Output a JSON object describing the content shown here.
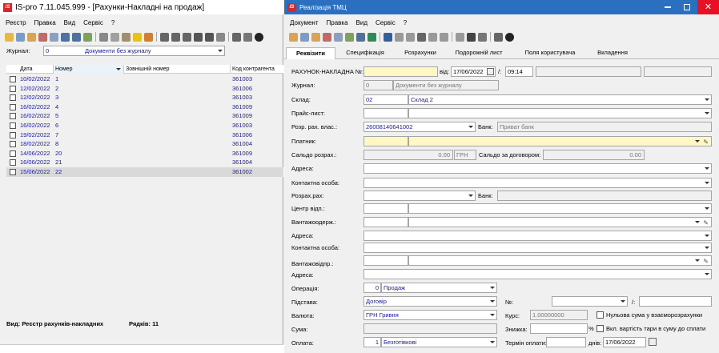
{
  "left_window": {
    "title": "IS-pro 7.11.045.999 - [Рахунки-Накладні на продаж]",
    "logo": "IS",
    "menu": [
      "Реєстр",
      "Правка",
      "Вид",
      "Сервіс",
      "?"
    ],
    "journal_label": "Журнал:",
    "journal_num": "0",
    "journal_value": "Документи без журналу",
    "columns": [
      "Дата",
      "Номер",
      "Зовнішній номер",
      "Код контрагента"
    ],
    "rows": [
      {
        "date": "10/02/2022",
        "num": "1",
        "ext": "",
        "code": "361003"
      },
      {
        "date": "12/02/2022",
        "num": "2",
        "ext": "",
        "code": "361006"
      },
      {
        "date": "12/02/2022",
        "num": "3",
        "ext": "",
        "code": "361003"
      },
      {
        "date": "16/02/2022",
        "num": "4",
        "ext": "",
        "code": "361009"
      },
      {
        "date": "16/02/2022",
        "num": "5",
        "ext": "",
        "code": "361009"
      },
      {
        "date": "16/02/2022",
        "num": "6",
        "ext": "",
        "code": "361003"
      },
      {
        "date": "19/02/2022",
        "num": "7",
        "ext": "",
        "code": "361006"
      },
      {
        "date": "18/02/2022",
        "num": "8",
        "ext": "",
        "code": "361004"
      },
      {
        "date": "14/06/2022",
        "num": "20",
        "ext": "",
        "code": "361009"
      },
      {
        "date": "16/06/2022",
        "num": "21",
        "ext": "",
        "code": "361004"
      },
      {
        "date": "15/06/2022",
        "num": "22",
        "ext": "",
        "code": "361002"
      }
    ],
    "status_view": "Вид: Реєстр рахунків-накладних",
    "status_rows": "Рядків: 11"
  },
  "dialog": {
    "title": "Реалізація ТМЦ",
    "menu": [
      "Документ",
      "Правка",
      "Вид",
      "Сервіс",
      "?"
    ],
    "tabs": [
      "Реквізити",
      "Специфікація",
      "Розрахунки",
      "Подорожній лист",
      "Поля користувача",
      "Вкладення"
    ],
    "invoice_label": "РАХУНОК-НАКЛАДНА №:",
    "invoice_num": "",
    "from_label": "від:",
    "date": "17/06/2022",
    "time": "09:14",
    "journal_label": "Журнал:",
    "journal_num": "0",
    "journal_value": "Документи без журналу",
    "warehouse_label": "Склад:",
    "warehouse_num": "02",
    "warehouse_value": "Склад 2",
    "pricelist_label": "Прайс-лист:",
    "own_account_label": "Розр. рах. влас.:",
    "own_account_value": "26008140641002",
    "bank_label": "Банк:",
    "bank_value": "Приват банк",
    "payer_label": "Платник:",
    "saldo_label": "Сальдо розрах.:",
    "saldo_value": "0.00",
    "currency_short": "ГРН",
    "saldo_contract_label": "Сальдо за договором:",
    "saldo_contract_value": "0.00",
    "address_label": "Адреса:",
    "contact_label": "Контактна особа:",
    "calc_account_label": "Розрах.рах:",
    "bank2_label": "Банк:",
    "resp_center_label": "Центр відп.:",
    "consignee_label": "Вантажоодерж.:",
    "address2_label": "Адреса:",
    "contact2_label": "Контактна особа:",
    "shipper_label": "Вантажовідпр.:",
    "address3_label": "Адреса:",
    "operation_label": "Операція:",
    "operation_num": "0",
    "operation_value": "Продаж",
    "basis_label": "Підстава:",
    "basis_value": "Договір",
    "no_label": "№:",
    "slash": "/:",
    "currency_label": "Валюта:",
    "currency_value": "ГРН Гривня",
    "rate_label": "Курс:",
    "rate_value": "1.00000000",
    "zero_sum_label": "Нульова сума у взаєморозрахунки",
    "sum_label": "Сума:",
    "discount_label": "Знижка:",
    "percent": "%",
    "tare_label": "Вкл. вартість тари в суму до сплати",
    "payment_label": "Оплата:",
    "payment_num": "1",
    "payment_value": "Безготівкові",
    "term_label": "Термін оплати:",
    "days_label": "днів:",
    "term_date": "17/06/2022"
  },
  "colors": {
    "accent": "#1a1aa0",
    "titlebar_active": "#ffffff",
    "close": "#e81123",
    "input_yellow": "#fff7c4"
  }
}
